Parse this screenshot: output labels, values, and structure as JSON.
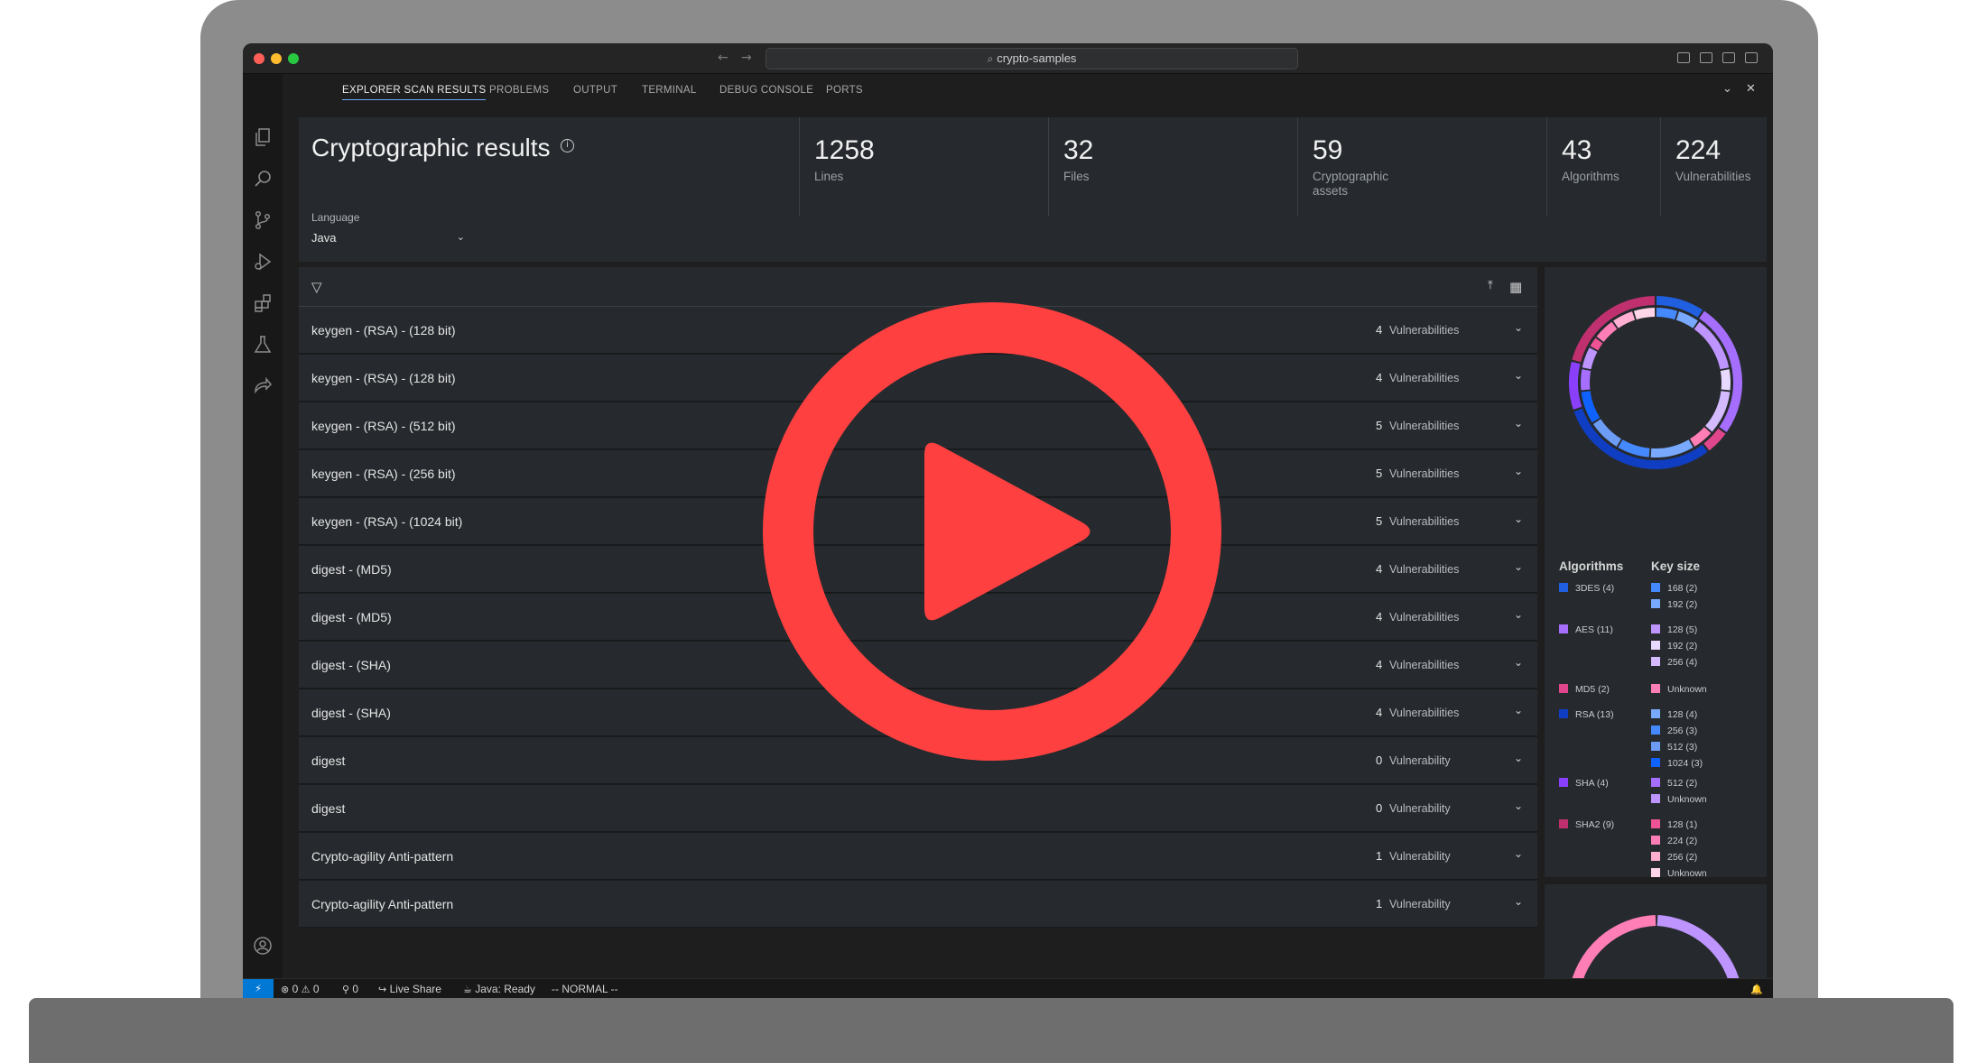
{
  "window": {
    "search_text": "crypto-samples"
  },
  "tabs": [
    {
      "label": "EXPLORER SCAN RESULTS"
    },
    {
      "label": "PROBLEMS"
    },
    {
      "label": "OUTPUT"
    },
    {
      "label": "TERMINAL"
    },
    {
      "label": "DEBUG CONSOLE"
    },
    {
      "label": "PORTS"
    }
  ],
  "header": {
    "title": "Cryptographic results",
    "stats": [
      {
        "value": "1258",
        "label": "Lines"
      },
      {
        "value": "32",
        "label": "Files"
      },
      {
        "value": "59",
        "label": "Cryptographic assets"
      },
      {
        "value": "43",
        "label": "Algorithms"
      },
      {
        "value": "224",
        "label": "Vulnerabilities"
      }
    ],
    "language_label": "Language",
    "language_value": "Java"
  },
  "results": [
    {
      "name": "keygen - (RSA) - (128 bit)",
      "count": "4",
      "unit": "Vulnerabilities"
    },
    {
      "name": "keygen - (RSA) - (128 bit)",
      "count": "4",
      "unit": "Vulnerabilities"
    },
    {
      "name": "keygen - (RSA) - (512 bit)",
      "count": "5",
      "unit": "Vulnerabilities"
    },
    {
      "name": "keygen - (RSA) - (256 bit)",
      "count": "5",
      "unit": "Vulnerabilities"
    },
    {
      "name": "keygen - (RSA) - (1024 bit)",
      "count": "5",
      "unit": "Vulnerabilities"
    },
    {
      "name": "digest - (MD5)",
      "count": "4",
      "unit": "Vulnerabilities"
    },
    {
      "name": "digest - (MD5)",
      "count": "4",
      "unit": "Vulnerabilities"
    },
    {
      "name": "digest - (SHA)",
      "count": "4",
      "unit": "Vulnerabilities"
    },
    {
      "name": "digest - (SHA)",
      "count": "4",
      "unit": "Vulnerabilities"
    },
    {
      "name": "digest",
      "count": "0",
      "unit": "Vulnerability"
    },
    {
      "name": "digest",
      "count": "0",
      "unit": "Vulnerability"
    },
    {
      "name": "Crypto-agility Anti-pattern",
      "count": "1",
      "unit": "Vulnerability"
    },
    {
      "name": "Crypto-agility Anti-pattern",
      "count": "1",
      "unit": "Vulnerability"
    }
  ],
  "chart_data": {
    "type": "pie",
    "legend_titles": {
      "algorithms": "Algorithms",
      "key_size": "Key size"
    },
    "algorithms": [
      {
        "label": "3DES (4)",
        "value": 4,
        "color": "#1f5fe0"
      },
      {
        "label": "AES (11)",
        "value": 11,
        "color": "#a56eff"
      },
      {
        "label": "MD5 (2)",
        "value": 2,
        "color": "#e0468c"
      },
      {
        "label": "RSA (13)",
        "value": 13,
        "color": "#0f3ec2"
      },
      {
        "label": "SHA (4)",
        "value": 4,
        "color": "#8a3ffc"
      },
      {
        "label": "SHA2 (9)",
        "value": 9,
        "color": "#c0306f"
      }
    ],
    "key_sizes": [
      {
        "label": "168 (2)",
        "value": 2,
        "color": "#4589ff",
        "group": 0
      },
      {
        "label": "192 (2)",
        "value": 2,
        "color": "#78a9ff",
        "group": 0
      },
      {
        "label": "128 (5)",
        "value": 5,
        "color": "#be95ff",
        "group": 1
      },
      {
        "label": "192 (2)",
        "value": 2,
        "color": "#e8daff",
        "group": 1
      },
      {
        "label": "256 (4)",
        "value": 4,
        "color": "#d4bbff",
        "group": 1
      },
      {
        "label": "Unknown",
        "value": 2,
        "color": "#ff7eb6",
        "group": 2
      },
      {
        "label": "128 (4)",
        "value": 4,
        "color": "#78a9ff",
        "group": 3
      },
      {
        "label": "256 (3)",
        "value": 3,
        "color": "#4589ff",
        "group": 3
      },
      {
        "label": "512 (3)",
        "value": 3,
        "color": "#6d9cf5",
        "group": 3
      },
      {
        "label": "1024 (3)",
        "value": 3,
        "color": "#0f62fe",
        "group": 3
      },
      {
        "label": "512 (2)",
        "value": 2,
        "color": "#a56eff",
        "group": 4
      },
      {
        "label": "Unknown",
        "value": 2,
        "color": "#be95ff",
        "group": 4
      },
      {
        "label": "128 (1)",
        "value": 1,
        "color": "#ee5396",
        "group": 5
      },
      {
        "label": "224 (2)",
        "value": 2,
        "color": "#ff7eb6",
        "group": 5
      },
      {
        "label": "256 (2)",
        "value": 2,
        "color": "#ffafd2",
        "group": 5
      },
      {
        "label": "Unknown",
        "value": 2,
        "color": "#ffd6e8",
        "group": 5
      }
    ]
  },
  "statusbar": {
    "errors": "0",
    "warnings": "0",
    "ports": "0",
    "live_share": "Live Share",
    "java_status": "Java: Ready",
    "vim_mode": "-- NORMAL --"
  },
  "colors": {
    "accent": "#0078d4",
    "play_button": "#ff4040"
  }
}
